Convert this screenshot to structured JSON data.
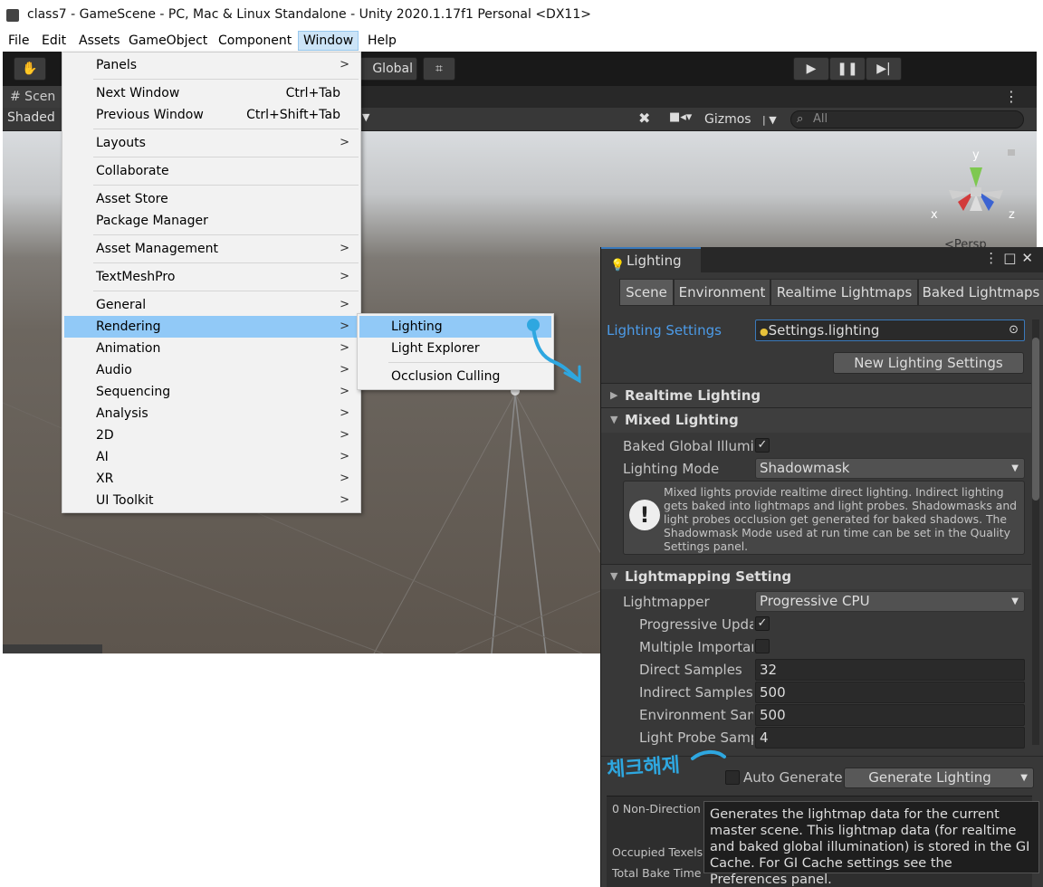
{
  "window_title": "class7 - GameScene - PC, Mac & Linux Standalone - Unity 2020.1.17f1 Personal <DX11>",
  "menubar": [
    "File",
    "Edit",
    "Assets",
    "GameObject",
    "Component",
    "Window",
    "Help"
  ],
  "toolbar": {
    "global_label": "Global"
  },
  "scene": {
    "tab_label": "# Scen",
    "shaded_label": "Shaded",
    "gizmos_label": "Gizmos",
    "search_placeholder": "All",
    "persp_label": "<Persp",
    "axis_x": "x",
    "axis_y": "y",
    "axis_z": "z"
  },
  "window_menu": {
    "panels": "Panels",
    "next_window": "Next Window",
    "next_window_shortcut": "Ctrl+Tab",
    "previous_window": "Previous Window",
    "previous_window_shortcut": "Ctrl+Shift+Tab",
    "layouts": "Layouts",
    "collaborate": "Collaborate",
    "asset_store": "Asset Store",
    "package_manager": "Package Manager",
    "asset_management": "Asset Management",
    "textmeshpro": "TextMeshPro",
    "general": "General",
    "rendering": "Rendering",
    "animation": "Animation",
    "audio": "Audio",
    "sequencing": "Sequencing",
    "analysis": "Analysis",
    "2d": "2D",
    "ai": "AI",
    "xr": "XR",
    "ui_toolkit": "UI Toolkit"
  },
  "rendering_menu": {
    "lighting": "Lighting",
    "light_explorer": "Light Explorer",
    "occlusion_culling": "Occlusion Culling"
  },
  "lighting_window": {
    "tab_title": "Lighting",
    "tabs": [
      "Scene",
      "Environment",
      "Realtime Lightmaps",
      "Baked Lightmaps"
    ],
    "settings_label": "Lighting Settings",
    "settings_value": "Settings.lighting",
    "new_settings_button": "New Lighting Settings",
    "realtime_lighting": "Realtime Lighting",
    "mixed_lighting": "Mixed Lighting",
    "baked_gi_label": "Baked Global Illumir",
    "lighting_mode_label": "Lighting Mode",
    "lighting_mode_value": "Shadowmask",
    "info_text": "Mixed lights provide realtime direct lighting. Indirect lighting gets baked into lightmaps and light probes. Shadowmasks and light probes occlusion get generated for baked shadows. The Shadowmask Mode used at run time can be set in the Quality Settings panel.",
    "lightmapping_settings": "Lightmapping Setting",
    "lightmapper_label": "Lightmapper",
    "lightmapper_value": "Progressive CPU",
    "progressive_updates_label": "Progressive Upda",
    "multiple_importance_label": "Multiple Importan",
    "direct_samples_label": "Direct Samples",
    "direct_samples_value": "32",
    "indirect_samples_label": "Indirect Samples",
    "indirect_samples_value": "500",
    "environment_samples_label": "Environment Sam",
    "environment_samples_value": "500",
    "light_probe_samples_label": "Light Probe Samp",
    "light_probe_samples_value": "4",
    "auto_generate_label": "Auto Generate",
    "generate_lighting_button": "Generate Lighting",
    "bottom_line_1": "0 Non-Direction",
    "bottom_line_2": "Occupied Texels",
    "bottom_line_3": "Total Bake Time"
  },
  "tooltip_text": "Generates the lightmap data for the current master scene.  This lightmap data (for realtime and baked global illumination) is stored in the GI Cache. For GI Cache settings see the Preferences panel.",
  "annotation_note": "체크해제",
  "colors": {
    "accent": "#2ea7e0",
    "menu_highlight": "#91c9f7",
    "link_blue": "#4c9be8"
  }
}
